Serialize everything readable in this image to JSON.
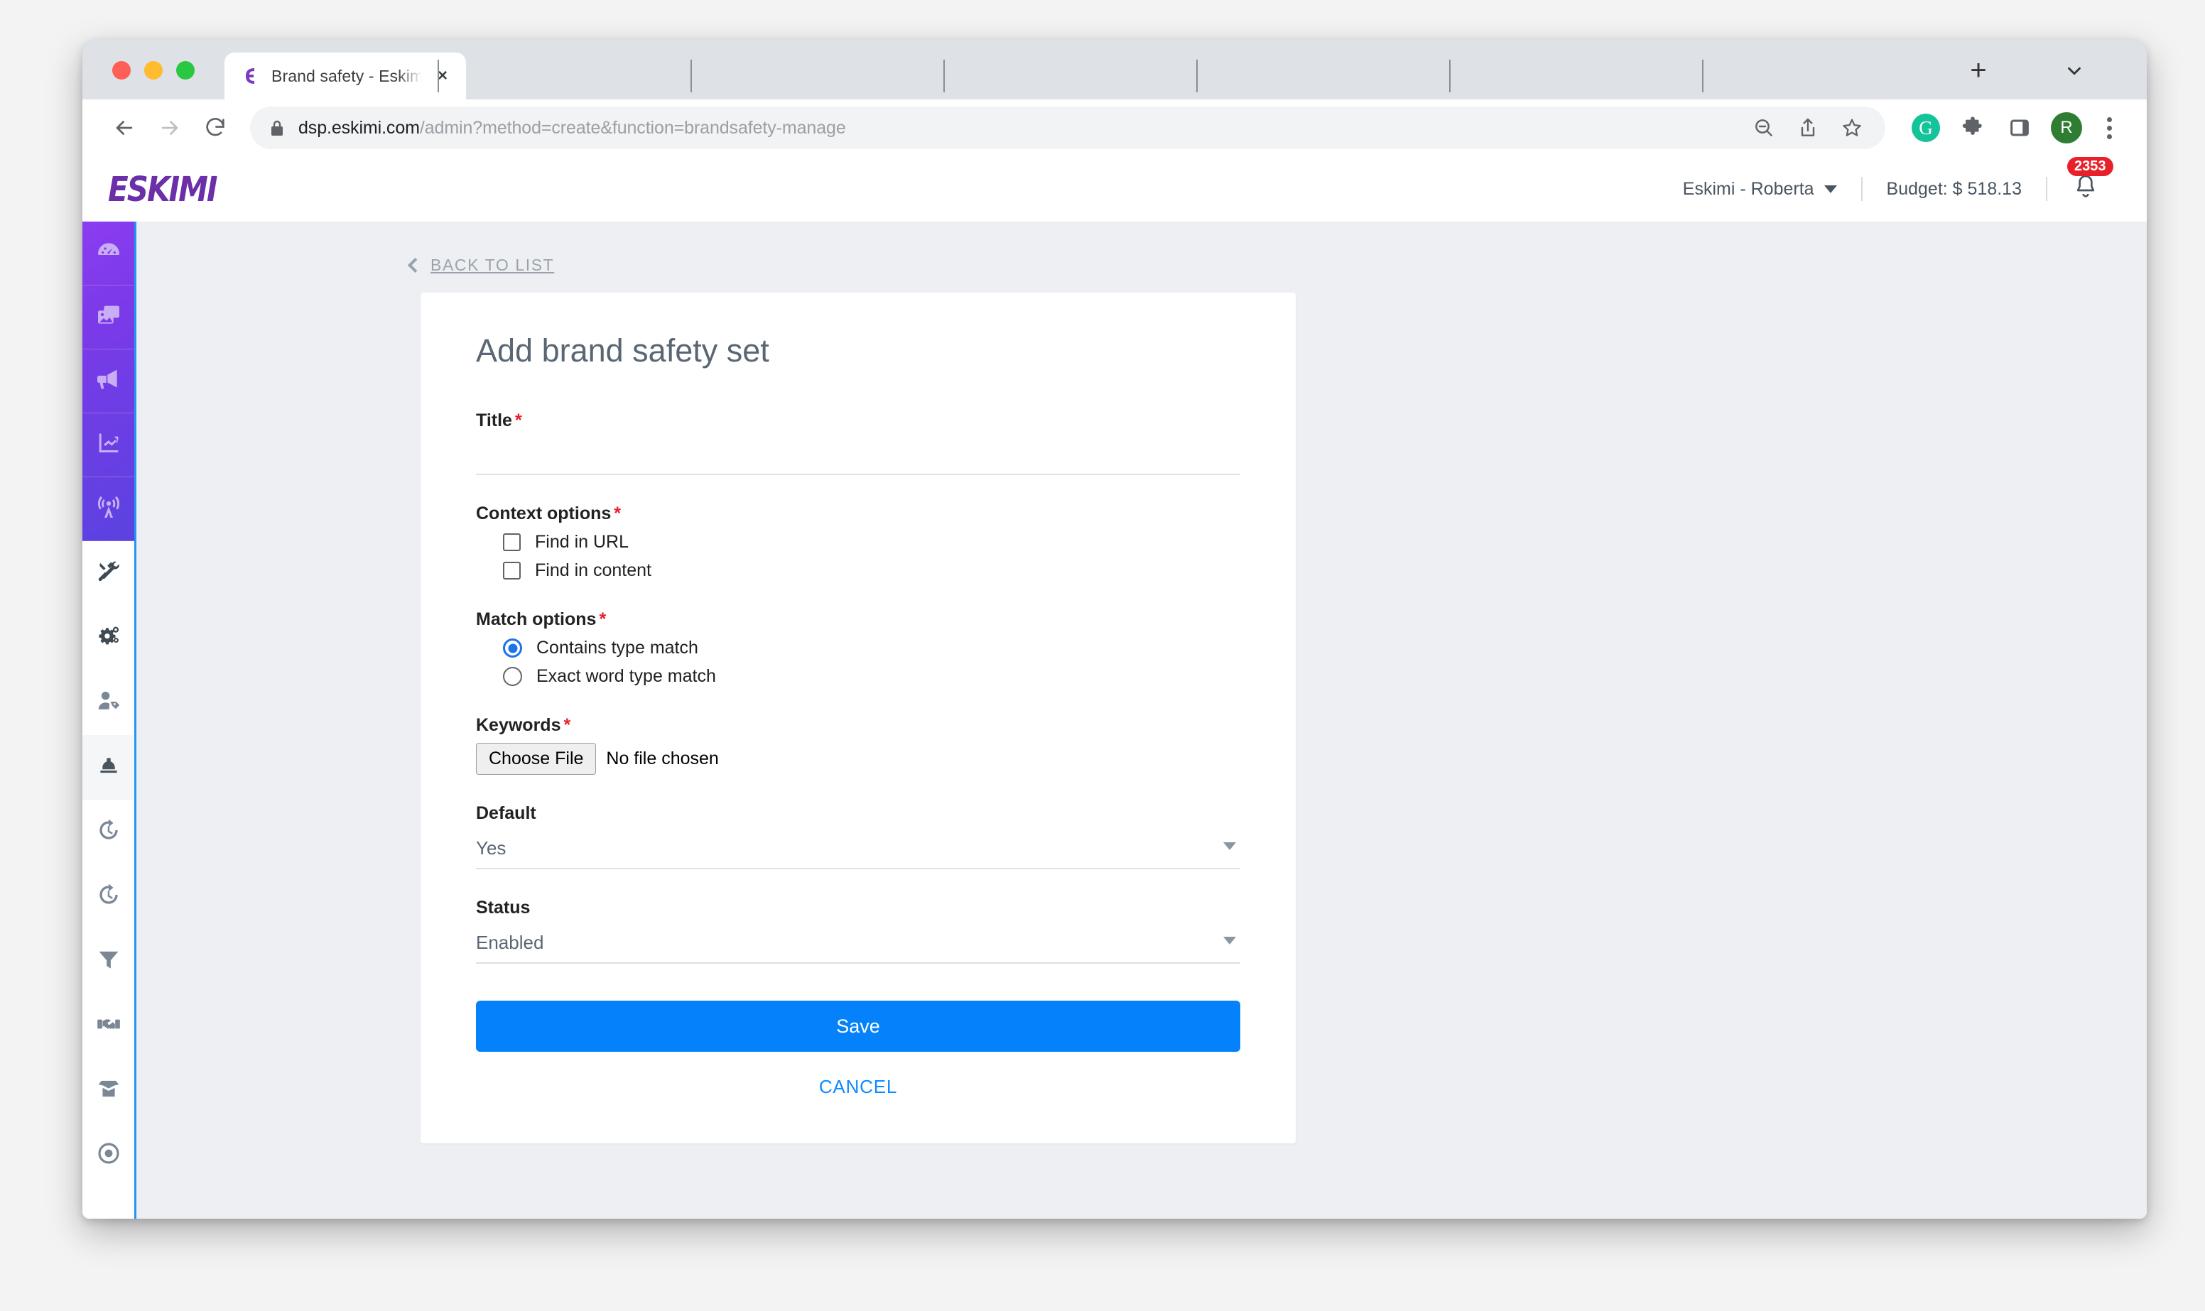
{
  "browser": {
    "tab": {
      "title": "Brand safety - Eskim",
      "favicon": "eskimi-favicon-icon",
      "close": "×"
    },
    "new_tab_label": "+",
    "tab_list_chevron": "chevron-down-icon",
    "nav": {
      "back": "back-arrow-icon",
      "forward": "forward-arrow-icon",
      "reload": "reload-icon"
    },
    "omnibox": {
      "lock": "lock-icon",
      "url_domain": "dsp.eskimi.com",
      "url_path": "/admin?method=create&function=brandsafety-manage",
      "zoom_out_icon": "zoom-out-icon",
      "share_icon": "share-icon",
      "bookmark_icon": "star-icon"
    },
    "extensions": {
      "grammarly": "G",
      "puzzle": "extensions-puzzle-icon",
      "sidepanel": "side-panel-icon",
      "profile_initial": "R",
      "menu": "kebab-menu-icon"
    },
    "empty_tab_separators": 4
  },
  "app": {
    "logo_text": "ESKIMI",
    "header": {
      "account": "Eskimi - Roberta",
      "budget": "Budget: $ 518.13",
      "notifications_badge": "2353",
      "bell_icon": "bell-icon"
    },
    "sidebar": {
      "top_items": [
        {
          "name": "dashboard",
          "icon": "speedometer-icon"
        },
        {
          "name": "creatives",
          "icon": "images-icon"
        },
        {
          "name": "campaigns",
          "icon": "megaphone-icon"
        },
        {
          "name": "reports",
          "icon": "chart-line-icon"
        },
        {
          "name": "audience",
          "icon": "broadcast-tower-icon"
        }
      ],
      "bottom_items": [
        {
          "name": "tools",
          "icon": "tools-icon",
          "active": false
        },
        {
          "name": "settings",
          "icon": "gears-icon",
          "active": false
        },
        {
          "name": "user-tags",
          "icon": "user-tag-icon",
          "active": false
        },
        {
          "name": "brand-safety",
          "icon": "hard-hat-icon",
          "active": true
        },
        {
          "name": "history",
          "icon": "history-clock-icon",
          "active": false
        },
        {
          "name": "history-2",
          "icon": "history-clock-icon",
          "active": false
        },
        {
          "name": "filters",
          "icon": "funnel-icon",
          "active": false
        },
        {
          "name": "deals",
          "icon": "handshake-icon",
          "active": false
        },
        {
          "name": "inventory",
          "icon": "open-box-icon",
          "active": false
        },
        {
          "name": "targeting",
          "icon": "target-circle-icon",
          "active": false
        }
      ]
    },
    "page": {
      "back_link": "BACK TO LIST",
      "card_title": "Add brand safety set",
      "fields": {
        "title": {
          "label": "Title",
          "required": "*",
          "value": "",
          "placeholder": ""
        },
        "context_options": {
          "label": "Context options",
          "required": "*",
          "options": [
            {
              "label": "Find in URL",
              "checked": false
            },
            {
              "label": "Find in content",
              "checked": false
            }
          ]
        },
        "match_options": {
          "label": "Match options",
          "required": "*",
          "options": [
            {
              "label": "Contains type match",
              "checked": true
            },
            {
              "label": "Exact word type match",
              "checked": false
            }
          ]
        },
        "keywords": {
          "label": "Keywords",
          "required": "*",
          "choose_file_label": "Choose File",
          "file_status": "No file chosen"
        },
        "default": {
          "label": "Default",
          "value": "Yes"
        },
        "status": {
          "label": "Status",
          "value": "Enabled"
        }
      },
      "save_label": "Save",
      "cancel_label": "CANCEL"
    }
  },
  "colors": {
    "brand_purple": "#6b2fa8",
    "sidebar_gradient_start": "#8b3df0",
    "sidebar_gradient_end": "#5b42e0",
    "sidebar_border": "#2196f3",
    "primary_button": "#0582fb",
    "link_blue": "#0d8bff",
    "required_red": "#e8202a",
    "page_background": "#edeff2",
    "radio_accent": "#1a73e8"
  }
}
